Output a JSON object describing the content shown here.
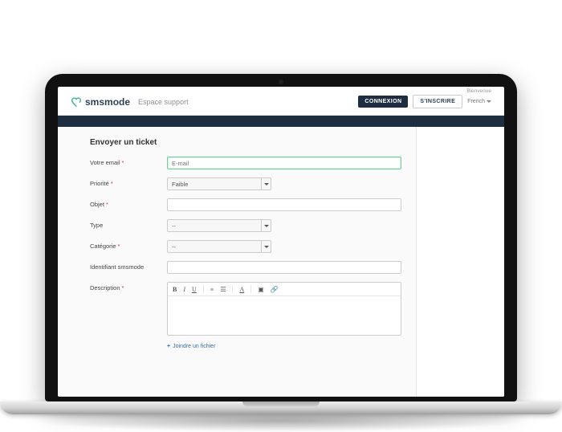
{
  "header": {
    "brand_name": "smsmode",
    "brand_sub": "Espace support",
    "welcome": "Bienvenue",
    "login_btn": "CONNEXION",
    "signup_btn": "S'INSCRIRE",
    "language": "French"
  },
  "form": {
    "title": "Envoyer un ticket",
    "email_label": "Votre email",
    "email_placeholder": "E-mail",
    "priority_label": "Priorité",
    "priority_value": "Faible",
    "subject_label": "Objet",
    "type_label": "Type",
    "type_value": "--",
    "category_label": "Catégorie",
    "category_value": "--",
    "identifier_label": "Identifiant smsmode",
    "description_label": "Description",
    "attach_label": "Joindre un fichier"
  },
  "colors": {
    "brand_green": "#3eb489",
    "brand_navy": "#1e2e40",
    "required": "#cc3344"
  }
}
